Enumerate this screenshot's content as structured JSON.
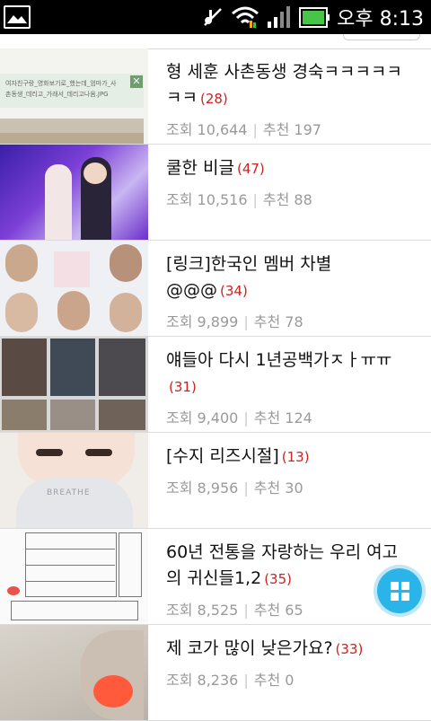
{
  "status_bar": {
    "time": "오후 8:13",
    "icons": [
      "gallery-icon",
      "mute-icon",
      "wifi-icon",
      "signal-icon",
      "battery-icon"
    ]
  },
  "posts": [
    {
      "title": "형 세훈 사촌동생 경숙ㅋㅋㅋㅋㅋㅋㅋ",
      "comments": "(28)",
      "views_label": "조회 10,644",
      "recommend_label": "추천 197",
      "thumb_text": [
        "여자친구랑_영화보기로_했는데_엄마가_사",
        "촌동생_데리고_가래서_데리고나옴.JPG"
      ]
    },
    {
      "title": "쿨한 비글",
      "comments": "(47)",
      "views_label": "조회 10,516",
      "recommend_label": "추천 88"
    },
    {
      "title": "[링크]한국인 멤버 차별@@@",
      "comments": "(34)",
      "views_label": "조회 9,899",
      "recommend_label": "추천 78"
    },
    {
      "title": "얘들아 다시 1년공백가ㅈㅏㅠㅠ",
      "comments": "(31)",
      "views_label": "조회 9,400",
      "recommend_label": "추천 124"
    },
    {
      "title": "[수지 리즈시절]",
      "comments": "(13)",
      "views_label": "조회 8,956",
      "recommend_label": "추천 30",
      "thumb_text": [
        "BREATHE"
      ]
    },
    {
      "title": "60년 전통을 자랑하는 우리 여고의 귀신들1,2",
      "comments": "(35)",
      "views_label": "조회 8,525",
      "recommend_label": "추천 65"
    },
    {
      "title": "제 코가 많이 낮은가요?",
      "comments": "(33)",
      "views_label": "조회 8,236",
      "recommend_label": "추천 0"
    }
  ],
  "fab": {
    "icon": "grid-icon"
  },
  "colors": {
    "accent": "#2bb4e8",
    "comment_count": "#d02020",
    "meta": "#9a9a9a"
  }
}
